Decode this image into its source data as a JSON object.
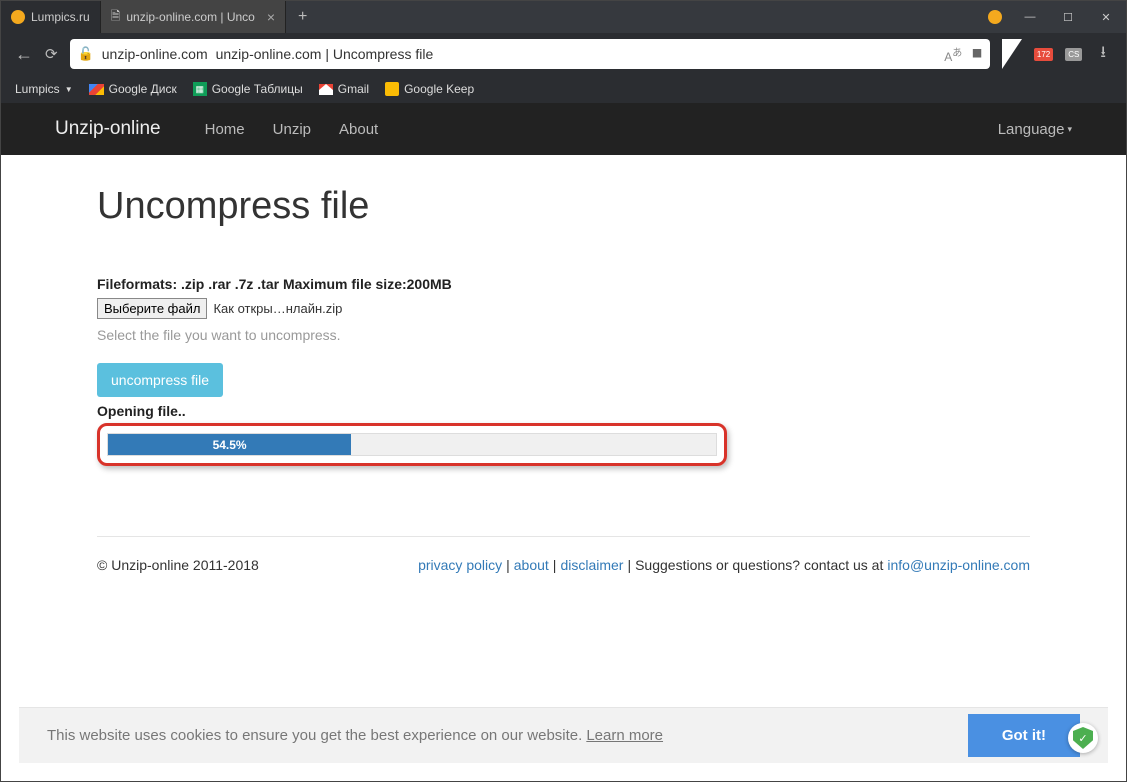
{
  "tabs": [
    {
      "label": "Lumpics.ru"
    },
    {
      "label": "unzip-online.com | Unco"
    }
  ],
  "address": {
    "domain": "unzip-online.com",
    "title": "unzip-online.com | Uncompress file",
    "translate": "A",
    "calendar_badge": "172",
    "cs_badge": "CS"
  },
  "bookmarks": {
    "lumplics": "Lumpics",
    "drive": "Google Диск",
    "sheets": "Google Таблицы",
    "gmail": "Gmail",
    "keep": "Google Keep"
  },
  "nav": {
    "brand": "Unzip-online",
    "home": "Home",
    "unzip": "Unzip",
    "about": "About",
    "language": "Language"
  },
  "page": {
    "heading": "Uncompress file",
    "formats": "Fileformats: .zip .rar .7z .tar Maximum file size:200MB",
    "choose": "Выберите файл",
    "filename": "Как откры…нлайн.zip",
    "helper": "Select the file you want to uncompress.",
    "button": "uncompress file",
    "status": "Opening file..",
    "progress_pct": "54.5%"
  },
  "footer": {
    "copyright": "© Unzip-online 2011-2018",
    "privacy": "privacy policy",
    "about": "about",
    "disclaimer": "disclaimer",
    "contact_text": "Suggestions or questions? contact us at",
    "email": "info@unzip-online.com"
  },
  "cookie": {
    "text": "This website uses cookies to ensure you get the best experience on our website.",
    "learn": "Learn more",
    "button": "Got it!"
  }
}
